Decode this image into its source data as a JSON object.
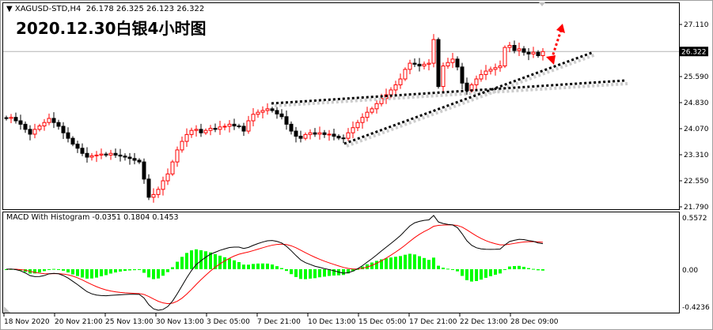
{
  "header": {
    "symbol": "XAGUSD-STD,H4",
    "ohlc": "26.178 26.325 26.123 26.322",
    "title": "2020.12.30白银4小时图"
  },
  "macd_label": "MACD With Histogram -0.0351 0.1804 0.1453",
  "colors": {
    "up": "#ff0000",
    "down": "#000000",
    "macd": "#000000",
    "signal": "#ff0000",
    "hist": "#00ff00",
    "arrow": "#ff0000"
  },
  "chart_data": [
    {
      "type": "candlestick",
      "title": "XAGUSD-STD,H4",
      "y_ticks": [
        "27.110",
        "25.590",
        "24.830",
        "24.070",
        "23.310",
        "22.550",
        "21.790"
      ],
      "ylim": [
        21.79,
        27.11
      ],
      "current_price": "26.322",
      "x_ticks": [
        "18 Nov 2020",
        "20 Nov 21:00",
        "25 Nov 13:00",
        "30 Nov 13:00",
        "3 Dec 05:00",
        "7 Dec 21:00",
        "10 Dec 13:00",
        "15 Dec 05:00",
        "17 Dec 21:00",
        "22 Dec 13:00",
        "28 Dec 09:00"
      ],
      "closes": [
        24.37,
        24.4,
        24.3,
        24.2,
        24.05,
        23.91,
        24.05,
        24.15,
        24.25,
        24.37,
        24.25,
        24.14,
        23.95,
        23.79,
        23.62,
        23.5,
        23.35,
        23.24,
        23.28,
        23.3,
        23.33,
        23.3,
        23.35,
        23.3,
        23.27,
        23.24,
        23.2,
        23.15,
        23.1,
        22.6,
        22.07,
        22.15,
        22.3,
        22.55,
        22.75,
        23.1,
        23.45,
        23.7,
        23.9,
        24.02,
        24.05,
        23.95,
        24.02,
        24.08,
        24.05,
        24.12,
        24.14,
        24.2,
        24.15,
        24.14,
        24.0,
        24.3,
        24.49,
        24.55,
        24.6,
        24.65,
        24.6,
        24.5,
        24.42,
        24.2,
        24.0,
        23.85,
        23.79,
        23.9,
        23.95,
        23.91,
        23.95,
        23.9,
        23.91,
        23.85,
        23.8,
        23.79,
        23.95,
        24.1,
        24.25,
        24.4,
        24.55,
        24.65,
        24.8,
        24.95,
        25.06,
        25.2,
        25.35,
        25.52,
        25.8,
        25.98,
        25.95,
        25.9,
        25.95,
        25.98,
        26.67,
        25.3,
        25.9,
        26.0,
        26.1,
        25.87,
        25.4,
        25.18,
        25.35,
        25.52,
        25.65,
        25.75,
        25.8,
        25.85,
        25.9,
        26.44,
        26.5,
        26.35,
        26.4,
        26.3,
        26.25,
        26.3,
        26.2,
        26.32
      ]
    },
    {
      "type": "macd",
      "title": "MACD With Histogram",
      "y_ticks": [
        "0.5572",
        "0.00",
        "-0.4236"
      ],
      "ylim": [
        -0.4236,
        0.5572
      ],
      "values": {
        "histogram": "-0.0351",
        "macd": "0.1804",
        "signal": "0.1453"
      }
    }
  ]
}
